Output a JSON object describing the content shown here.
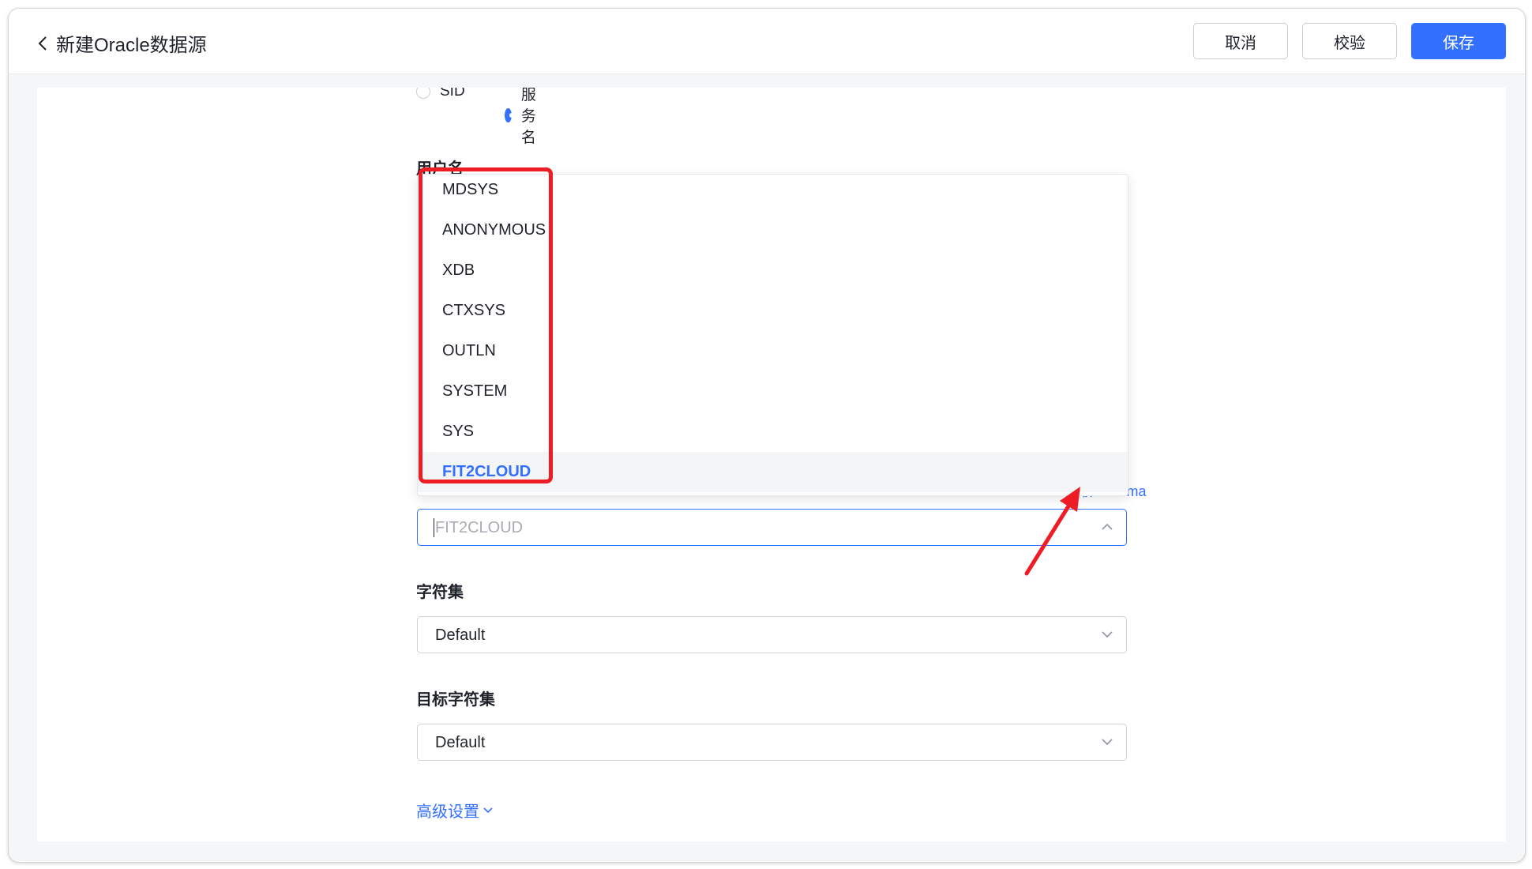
{
  "header": {
    "title": "新建Oracle数据源",
    "cancel_label": "取消",
    "validate_label": "校验",
    "save_label": "保存"
  },
  "connection": {
    "options": [
      {
        "label": "SID",
        "selected": false
      },
      {
        "label": "服务名",
        "selected": true
      }
    ]
  },
  "username": {
    "label": "用户名"
  },
  "schema": {
    "get_schema_link": "+ 获取 schema",
    "placeholder": "FIT2CLOUD",
    "dropdown_items": [
      "MDSYS",
      "ANONYMOUS",
      "XDB",
      "CTXSYS",
      "OUTLN",
      "SYSTEM",
      "SYS",
      "FIT2CLOUD"
    ],
    "selected_item": "FIT2CLOUD"
  },
  "charset": {
    "label": "字符集",
    "value": "Default"
  },
  "target_charset": {
    "label": "目标字符集",
    "value": "Default"
  },
  "advanced": {
    "label": "高级设置"
  },
  "colors": {
    "primary": "#3370ff",
    "highlight_annotation": "#ee1c25"
  }
}
